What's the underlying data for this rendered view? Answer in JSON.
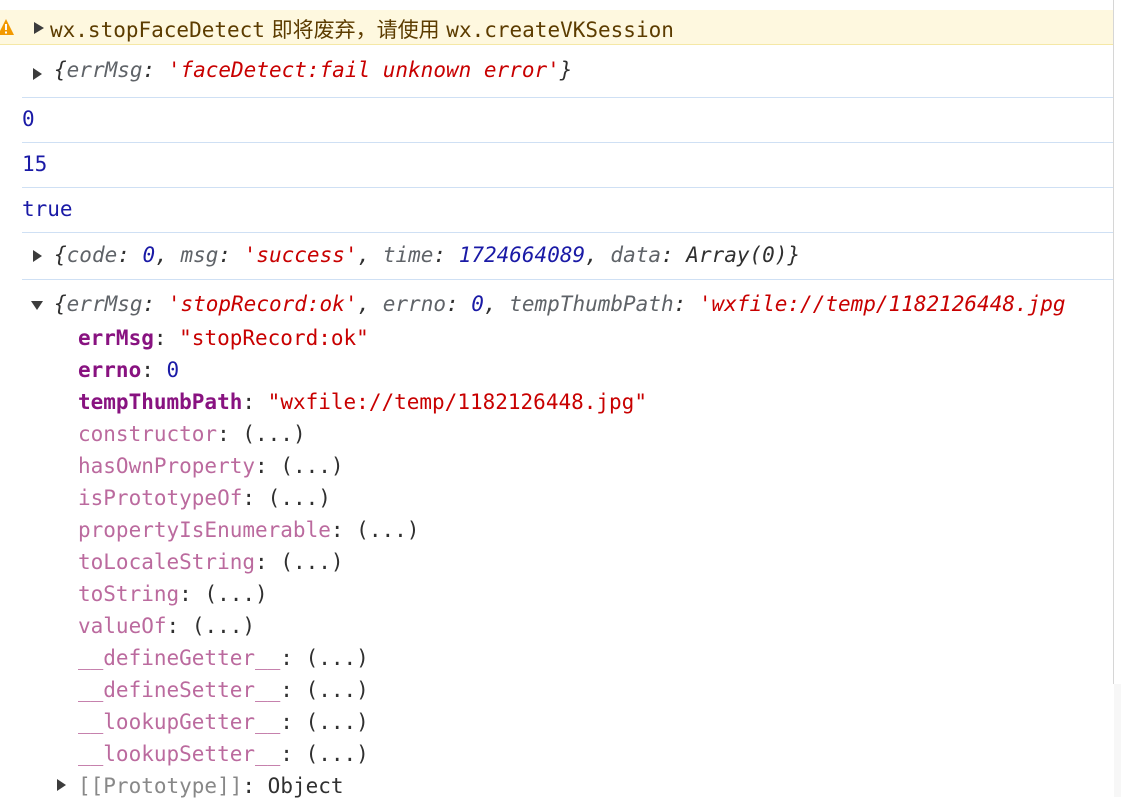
{
  "warning": {
    "api_old": "wx.stopFaceDetect",
    "cjk_text": " 即将废弃，请使用 ",
    "api_new": "wx.createVKSession"
  },
  "log_error": {
    "key": "errMsg",
    "value": "'faceDetect:fail unknown error'"
  },
  "log_values": [
    "0",
    "15",
    "true"
  ],
  "log_response": {
    "code_key": "code",
    "code_val": "0",
    "msg_key": "msg",
    "msg_val": "'success'",
    "time_key": "time",
    "time_val": "1724664089",
    "data_key": "data",
    "data_val": "Array(0)"
  },
  "log_record": {
    "summary": {
      "errMsg_key": "errMsg",
      "errMsg_val": "'stopRecord:ok'",
      "errno_key": "errno",
      "errno_val": "0",
      "path_key": "tempThumbPath",
      "path_val": "'wxfile://temp/1182126448.jpg"
    },
    "props": [
      {
        "key": "errMsg",
        "value": "\"stopRecord:ok\"",
        "kind": "string"
      },
      {
        "key": "errno",
        "value": "0",
        "kind": "number"
      },
      {
        "key": "tempThumbPath",
        "value": "\"wxfile://temp/1182126448.jpg\"",
        "kind": "string"
      }
    ],
    "inherited": [
      "constructor",
      "hasOwnProperty",
      "isPrototypeOf",
      "propertyIsEnumerable",
      "toLocaleString",
      "toString",
      "valueOf",
      "__defineGetter__",
      "__defineSetter__",
      "__lookupGetter__",
      "__lookupSetter__"
    ],
    "inherited_value": "(...)",
    "prototype_key": "[[Prototype]]",
    "prototype_val": "Object"
  },
  "colors": {
    "warning_bg": "#fef8df",
    "string": "#c80000",
    "number": "#1a1aa6",
    "own_key": "#881280",
    "inherited_key": "#bb6a9e"
  }
}
